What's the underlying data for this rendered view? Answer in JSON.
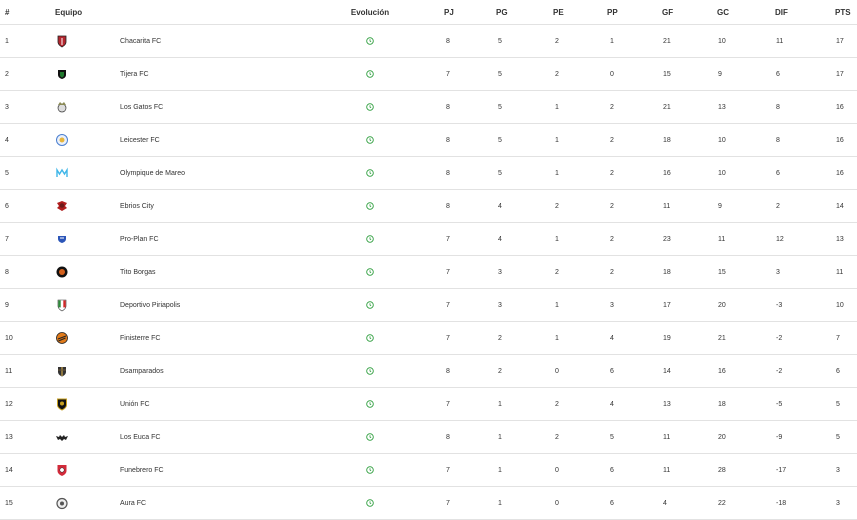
{
  "headers": {
    "pos": "#",
    "team": "Equipo",
    "evolution": "Evolución",
    "pj": "PJ",
    "pg": "PG",
    "pe": "PE",
    "pp": "PP",
    "gf": "GF",
    "gc": "GC",
    "dif": "DIF",
    "pts": "PTS"
  },
  "evolution_icon": "clock-icon",
  "colors": {
    "evolution_icon": "#2e9e3e",
    "row_border": "#e2e2e2"
  },
  "rows": [
    {
      "pos": "1",
      "team": "Chacarita FC",
      "crest": "shield-red-black",
      "crest_color": "#b3262e",
      "pj": "8",
      "pg": "5",
      "pe": "2",
      "pp": "1",
      "gf": "21",
      "gc": "10",
      "dif": "11",
      "pts": "17"
    },
    {
      "pos": "2",
      "team": "Tijera FC",
      "crest": "shield-green-black",
      "crest_color": "#1f7a2e",
      "pj": "7",
      "pg": "5",
      "pe": "2",
      "pp": "0",
      "gf": "15",
      "gc": "9",
      "dif": "6",
      "pts": "17"
    },
    {
      "pos": "3",
      "team": "Los Gatos FC",
      "crest": "cat-ball",
      "crest_color": "#8a8a55",
      "pj": "8",
      "pg": "5",
      "pe": "1",
      "pp": "2",
      "gf": "21",
      "gc": "13",
      "dif": "8",
      "pts": "16"
    },
    {
      "pos": "4",
      "team": "Leicester FC",
      "crest": "fox-circle",
      "crest_color": "#4a7fd0",
      "pj": "8",
      "pg": "5",
      "pe": "1",
      "pp": "2",
      "gf": "18",
      "gc": "10",
      "dif": "8",
      "pts": "16"
    },
    {
      "pos": "5",
      "team": "Olympique de Mareo",
      "crest": "om-letters",
      "crest_color": "#3fb6e8",
      "pj": "8",
      "pg": "5",
      "pe": "1",
      "pp": "2",
      "gf": "16",
      "gc": "10",
      "dif": "6",
      "pts": "16"
    },
    {
      "pos": "6",
      "team": "Ebrios City",
      "crest": "skull-red",
      "crest_color": "#6b1a1a",
      "pj": "8",
      "pg": "4",
      "pe": "2",
      "pp": "2",
      "gf": "11",
      "gc": "9",
      "dif": "2",
      "pts": "14"
    },
    {
      "pos": "7",
      "team": "Pro-Plan FC",
      "crest": "shield-blue",
      "crest_color": "#2b55b8",
      "pj": "7",
      "pg": "4",
      "pe": "1",
      "pp": "2",
      "gf": "23",
      "gc": "11",
      "dif": "12",
      "pts": "13"
    },
    {
      "pos": "8",
      "team": "Tito Borgas",
      "crest": "circle-orange-black",
      "crest_color": "#d4601c",
      "pj": "7",
      "pg": "3",
      "pe": "2",
      "pp": "2",
      "gf": "18",
      "gc": "15",
      "dif": "3",
      "pts": "11"
    },
    {
      "pos": "9",
      "team": "Deportivo Piriapolis",
      "crest": "shield-tricolor",
      "crest_color": "#2e8b3a",
      "pj": "7",
      "pg": "3",
      "pe": "1",
      "pp": "3",
      "gf": "17",
      "gc": "20",
      "dif": "-3",
      "pts": "10"
    },
    {
      "pos": "10",
      "team": "Finisterre FC",
      "crest": "circle-orange-stripes",
      "crest_color": "#e07a1a",
      "pj": "7",
      "pg": "2",
      "pe": "1",
      "pp": "4",
      "gf": "19",
      "gc": "21",
      "dif": "-2",
      "pts": "7"
    },
    {
      "pos": "11",
      "team": "Dsamparados",
      "crest": "shield-dark-gold",
      "crest_color": "#6b5a3a",
      "pj": "8",
      "pg": "2",
      "pe": "0",
      "pp": "6",
      "gf": "14",
      "gc": "16",
      "dif": "-2",
      "pts": "6"
    },
    {
      "pos": "12",
      "team": "Unión FC",
      "crest": "shield-black-gold",
      "crest_color": "#c8a020",
      "pj": "7",
      "pg": "1",
      "pe": "2",
      "pp": "4",
      "gf": "13",
      "gc": "18",
      "dif": "-5",
      "pts": "5"
    },
    {
      "pos": "13",
      "team": "Los Euca FC",
      "crest": "bat-black",
      "crest_color": "#222222",
      "pj": "8",
      "pg": "1",
      "pe": "2",
      "pp": "5",
      "gf": "11",
      "gc": "20",
      "dif": "-9",
      "pts": "5"
    },
    {
      "pos": "14",
      "team": "Funebrero FC",
      "crest": "shield-red-ball",
      "crest_color": "#d22a3a",
      "pj": "7",
      "pg": "1",
      "pe": "0",
      "pp": "6",
      "gf": "11",
      "gc": "28",
      "dif": "-17",
      "pts": "3"
    },
    {
      "pos": "15",
      "team": "Aura FC",
      "crest": "circle-gray",
      "crest_color": "#555555",
      "pj": "7",
      "pg": "1",
      "pe": "0",
      "pp": "6",
      "gf": "4",
      "gc": "22",
      "dif": "-18",
      "pts": "3"
    }
  ]
}
